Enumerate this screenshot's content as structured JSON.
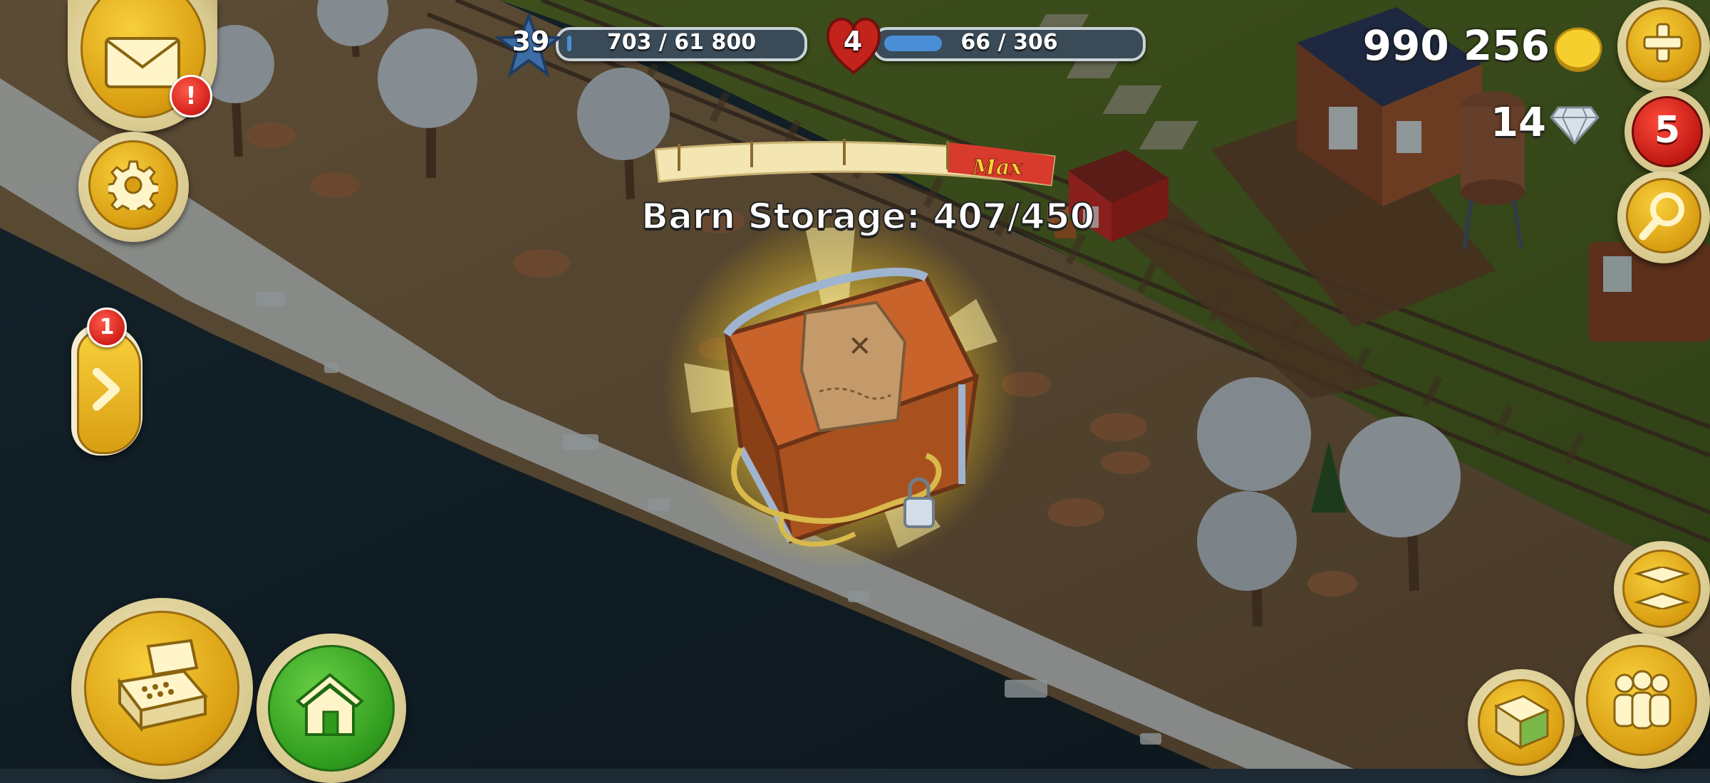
{
  "hud": {
    "level": "39",
    "xp_text": "703 / 61 800",
    "xp_fraction": 0.0114,
    "storage_level": "4",
    "storage_text": "66 / 306",
    "storage_fraction": 0.2157,
    "coins": "990 256",
    "diamonds": "14",
    "red_badge_count": "5"
  },
  "barn_popup": {
    "max_label": "Max",
    "title": "Barn Storage: 407/450",
    "fraction": 0.904
  },
  "side_tab": {
    "badge": "1"
  },
  "mail": {
    "alert": "!"
  },
  "icons": {
    "mail": "envelope-icon",
    "settings": "gear-icon",
    "expand": "chevron-right-icon",
    "shop": "cash-register-icon",
    "home": "house-icon",
    "add": "plus-icon",
    "search": "magnifier-icon",
    "map": "map-icon",
    "friends": "friends-icon",
    "coin": "coin-icon",
    "diamond": "diamond-icon"
  },
  "colors": {
    "accent_gold": "#f2c230",
    "alert_red": "#d2201a",
    "progress_blue": "#4a8fd6"
  }
}
